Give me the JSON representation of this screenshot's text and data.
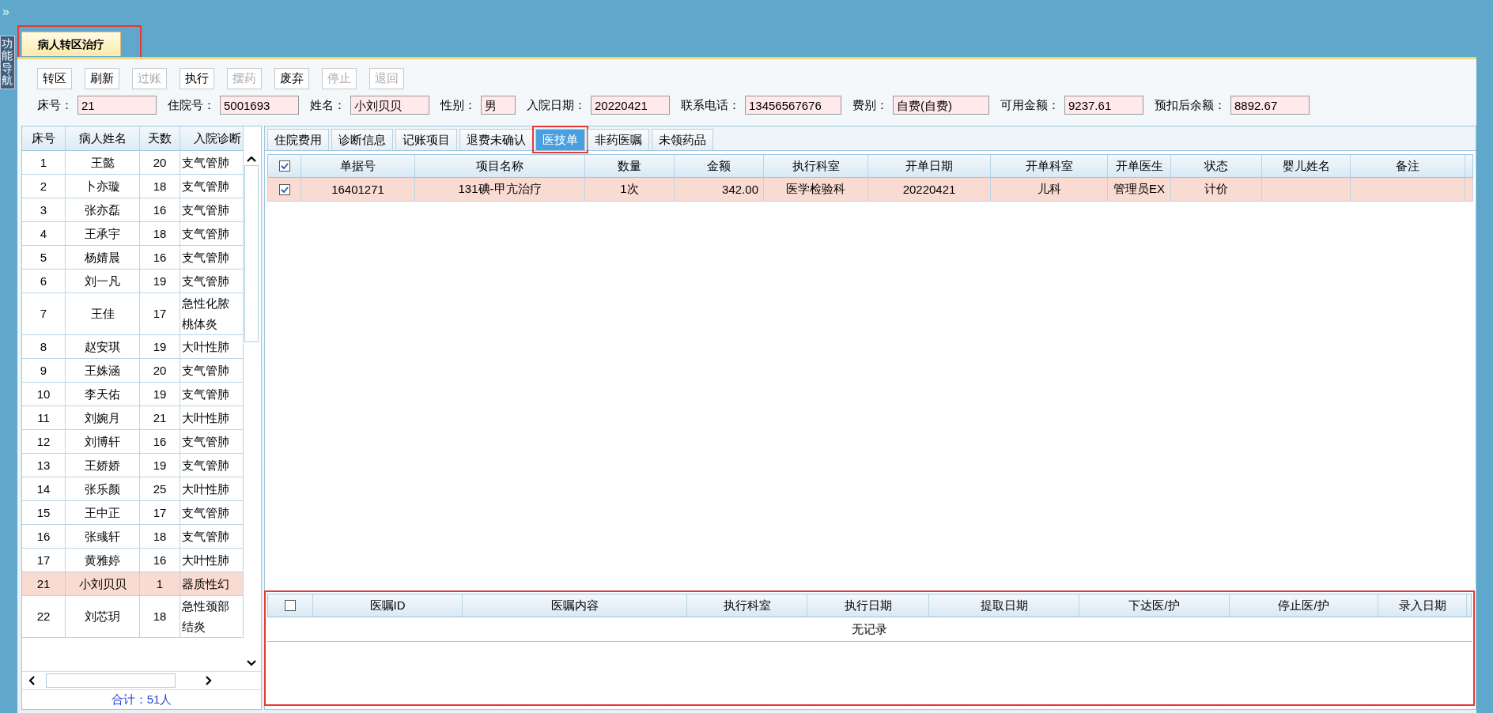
{
  "expand_glyph": "»",
  "side_tab": {
    "label": "功能导航"
  },
  "main_tabs": [
    {
      "label": "病人转区治疗",
      "selected": true,
      "highlighted": true
    }
  ],
  "toolbar": [
    {
      "label": "转区",
      "disabled": false
    },
    {
      "label": "刷新",
      "disabled": false
    },
    {
      "label": "过账",
      "disabled": true
    },
    {
      "label": "执行",
      "disabled": false
    },
    {
      "label": "摆药",
      "disabled": true
    },
    {
      "label": "废弃",
      "disabled": false
    },
    {
      "label": "停止",
      "disabled": true
    },
    {
      "label": "退回",
      "disabled": true
    }
  ],
  "patient_info": [
    {
      "label": "床号：",
      "value": "21"
    },
    {
      "label": "住院号：",
      "value": "5001693"
    },
    {
      "label": "姓名：",
      "value": "小刘贝贝"
    },
    {
      "label": "性别：",
      "value": "男"
    },
    {
      "label": "入院日期：",
      "value": "20220421"
    },
    {
      "label": "联系电话：",
      "value": "13456567676"
    },
    {
      "label": "费别：",
      "value": "自费(自费)"
    },
    {
      "label": "可用金额：",
      "value": "9237.61"
    },
    {
      "label": "预扣后余额：",
      "value": "8892.67"
    }
  ],
  "patient_list": {
    "columns": [
      "床号",
      "病人姓名",
      "天数",
      "入院诊断"
    ],
    "rows": [
      {
        "bed": "1",
        "name": "王懿",
        "days": "20",
        "diagnosis": [
          "支气管肺"
        ],
        "selected": false
      },
      {
        "bed": "2",
        "name": "卜亦璇",
        "days": "18",
        "diagnosis": [
          "支气管肺"
        ],
        "selected": false
      },
      {
        "bed": "3",
        "name": "张亦磊",
        "days": "16",
        "diagnosis": [
          "支气管肺"
        ],
        "selected": false
      },
      {
        "bed": "4",
        "name": "王承宇",
        "days": "18",
        "diagnosis": [
          "支气管肺"
        ],
        "selected": false
      },
      {
        "bed": "5",
        "name": "杨婧晨",
        "days": "16",
        "diagnosis": [
          "支气管肺"
        ],
        "selected": false
      },
      {
        "bed": "6",
        "name": "刘一凡",
        "days": "19",
        "diagnosis": [
          "支气管肺"
        ],
        "selected": false
      },
      {
        "bed": "7",
        "name": "王佳",
        "days": "17",
        "diagnosis": [
          "急性化脓",
          "桃体炎"
        ],
        "selected": false
      },
      {
        "bed": "8",
        "name": "赵安琪",
        "days": "19",
        "diagnosis": [
          "大叶性肺"
        ],
        "selected": false
      },
      {
        "bed": "9",
        "name": "王姝涵",
        "days": "20",
        "diagnosis": [
          "支气管肺"
        ],
        "selected": false
      },
      {
        "bed": "10",
        "name": "李天佑",
        "days": "19",
        "diagnosis": [
          "支气管肺"
        ],
        "selected": false
      },
      {
        "bed": "11",
        "name": "刘婉月",
        "days": "21",
        "diagnosis": [
          "大叶性肺"
        ],
        "selected": false
      },
      {
        "bed": "12",
        "name": "刘博轩",
        "days": "16",
        "diagnosis": [
          "支气管肺"
        ],
        "selected": false
      },
      {
        "bed": "13",
        "name": "王娇娇",
        "days": "19",
        "diagnosis": [
          "支气管肺"
        ],
        "selected": false
      },
      {
        "bed": "14",
        "name": "张乐颜",
        "days": "25",
        "diagnosis": [
          "大叶性肺"
        ],
        "selected": false
      },
      {
        "bed": "15",
        "name": "王中正",
        "days": "17",
        "diagnosis": [
          "支气管肺"
        ],
        "selected": false
      },
      {
        "bed": "16",
        "name": "张彧轩",
        "days": "18",
        "diagnosis": [
          "支气管肺"
        ],
        "selected": false
      },
      {
        "bed": "17",
        "name": "黄雅婷",
        "days": "16",
        "diagnosis": [
          "大叶性肺"
        ],
        "selected": false
      },
      {
        "bed": "21",
        "name": "小刘贝贝",
        "days": "1",
        "diagnosis": [
          "器质性幻"
        ],
        "selected": true
      },
      {
        "bed": "22",
        "name": "刘芯玥",
        "days": "18",
        "diagnosis": [
          "急性颈部",
          "结炎"
        ],
        "selected": false
      }
    ],
    "total": "合计：51人"
  },
  "detail_tabs": [
    {
      "label": "住院费用",
      "selected": false,
      "highlighted": false
    },
    {
      "label": "诊断信息",
      "selected": false,
      "highlighted": false
    },
    {
      "label": "记账项目",
      "selected": false,
      "highlighted": false
    },
    {
      "label": "退费未确认",
      "selected": false,
      "highlighted": false
    },
    {
      "label": "医技单",
      "selected": true,
      "highlighted": true
    },
    {
      "label": "非药医嘱",
      "selected": false,
      "highlighted": false
    },
    {
      "label": "未领药品",
      "selected": false,
      "highlighted": false
    }
  ],
  "orders_table": {
    "all_checked": true,
    "columns": [
      "单据号",
      "项目名称",
      "数量",
      "金额",
      "执行科室",
      "开单日期",
      "开单科室",
      "开单医生",
      "状态",
      "婴儿姓名",
      "备注"
    ],
    "rows": [
      {
        "checked": true,
        "selected": true,
        "cells": [
          "16401271",
          "131碘-甲亢治疗",
          "1次",
          "342.00",
          "医学检验科",
          "20220421",
          "儿科",
          "管理员EX",
          "计价",
          "",
          ""
        ]
      }
    ]
  },
  "advice_table": {
    "highlighted": true,
    "all_checked": false,
    "columns": [
      "医嘱ID",
      "医嘱内容",
      "执行科室",
      "执行日期",
      "提取日期",
      "下达医/护",
      "停止医/护",
      "录入日期"
    ],
    "empty_text": "无记录"
  }
}
